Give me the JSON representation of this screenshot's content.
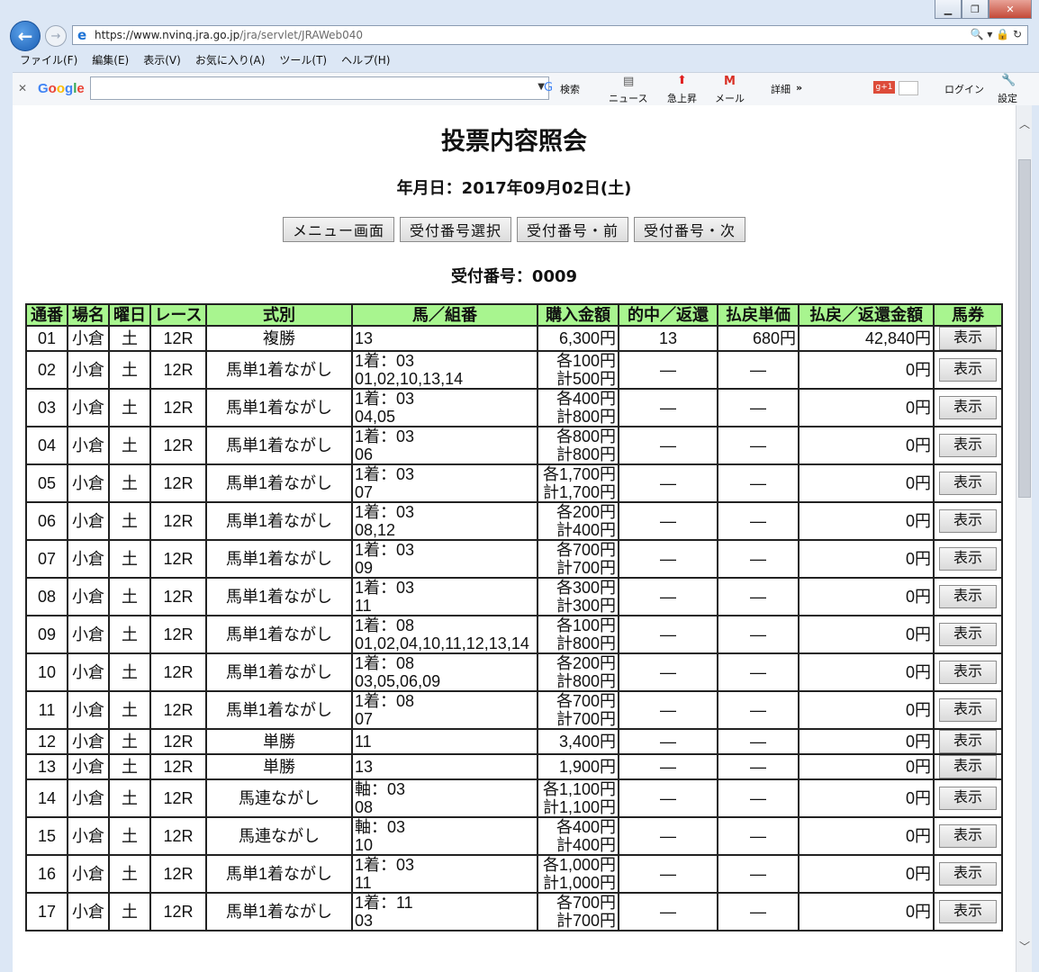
{
  "browser": {
    "url_host": "https://www.nvinq.jra.go.jp",
    "url_path": "/jra/servlet/JRAWeb040",
    "url_tools": "🔍 ▾ 🔒 ↻",
    "menu": [
      "ファイル(F)",
      "編集(E)",
      "表示(V)",
      "お気に入り(A)",
      "ツール(T)",
      "ヘルプ(H)"
    ],
    "toolbar": {
      "google_logo": "Google",
      "search_btn": "検索",
      "news": "ニュース",
      "trending": "急上昇",
      "mail": "メール",
      "details": "詳細",
      "more": "»",
      "login": "ログイン",
      "settings": "設定"
    }
  },
  "page": {
    "title": "投票内容照会",
    "date_line": "年月日：2017年09月02日(土)",
    "buttons": [
      "メニュー画面",
      "受付番号選択",
      "受付番号・前",
      "受付番号・次"
    ],
    "receipt_line": "受付番号：0009"
  },
  "table": {
    "headers": [
      "通番",
      "場名",
      "曜日",
      "レース",
      "式別",
      "馬／組番",
      "購入金額",
      "的中／返還",
      "払戻単価",
      "払戻／返還金額",
      "馬券"
    ],
    "rows": [
      {
        "no": "01",
        "venue": "小倉",
        "day": "土",
        "race": "12R",
        "type": "複勝",
        "combo1": "13",
        "combo2": "",
        "amt1": "6,300円",
        "amt2": "",
        "hit": "13",
        "unit": "680円",
        "payout": "42,840円",
        "btn": "表示"
      },
      {
        "no": "02",
        "venue": "小倉",
        "day": "土",
        "race": "12R",
        "type": "馬単1着ながし",
        "combo1": "1着：03",
        "combo2": "01,02,10,13,14",
        "amt1": "各100円",
        "amt2": "計500円",
        "hit": "—",
        "unit": "—",
        "payout": "0円",
        "btn": "表示"
      },
      {
        "no": "03",
        "venue": "小倉",
        "day": "土",
        "race": "12R",
        "type": "馬単1着ながし",
        "combo1": "1着：03",
        "combo2": "04,05",
        "amt1": "各400円",
        "amt2": "計800円",
        "hit": "—",
        "unit": "—",
        "payout": "0円",
        "btn": "表示"
      },
      {
        "no": "04",
        "venue": "小倉",
        "day": "土",
        "race": "12R",
        "type": "馬単1着ながし",
        "combo1": "1着：03",
        "combo2": "06",
        "amt1": "各800円",
        "amt2": "計800円",
        "hit": "—",
        "unit": "—",
        "payout": "0円",
        "btn": "表示"
      },
      {
        "no": "05",
        "venue": "小倉",
        "day": "土",
        "race": "12R",
        "type": "馬単1着ながし",
        "combo1": "1着：03",
        "combo2": "07",
        "amt1": "各1,700円",
        "amt2": "計1,700円",
        "hit": "—",
        "unit": "—",
        "payout": "0円",
        "btn": "表示"
      },
      {
        "no": "06",
        "venue": "小倉",
        "day": "土",
        "race": "12R",
        "type": "馬単1着ながし",
        "combo1": "1着：03",
        "combo2": "08,12",
        "amt1": "各200円",
        "amt2": "計400円",
        "hit": "—",
        "unit": "—",
        "payout": "0円",
        "btn": "表示"
      },
      {
        "no": "07",
        "venue": "小倉",
        "day": "土",
        "race": "12R",
        "type": "馬単1着ながし",
        "combo1": "1着：03",
        "combo2": "09",
        "amt1": "各700円",
        "amt2": "計700円",
        "hit": "—",
        "unit": "—",
        "payout": "0円",
        "btn": "表示"
      },
      {
        "no": "08",
        "venue": "小倉",
        "day": "土",
        "race": "12R",
        "type": "馬単1着ながし",
        "combo1": "1着：03",
        "combo2": "11",
        "amt1": "各300円",
        "amt2": "計300円",
        "hit": "—",
        "unit": "—",
        "payout": "0円",
        "btn": "表示"
      },
      {
        "no": "09",
        "venue": "小倉",
        "day": "土",
        "race": "12R",
        "type": "馬単1着ながし",
        "combo1": "1着：08",
        "combo2": "01,02,04,10,11,12,13,14",
        "amt1": "各100円",
        "amt2": "計800円",
        "hit": "—",
        "unit": "—",
        "payout": "0円",
        "btn": "表示"
      },
      {
        "no": "10",
        "venue": "小倉",
        "day": "土",
        "race": "12R",
        "type": "馬単1着ながし",
        "combo1": "1着：08",
        "combo2": "03,05,06,09",
        "amt1": "各200円",
        "amt2": "計800円",
        "hit": "—",
        "unit": "—",
        "payout": "0円",
        "btn": "表示"
      },
      {
        "no": "11",
        "venue": "小倉",
        "day": "土",
        "race": "12R",
        "type": "馬単1着ながし",
        "combo1": "1着：08",
        "combo2": "07",
        "amt1": "各700円",
        "amt2": "計700円",
        "hit": "—",
        "unit": "—",
        "payout": "0円",
        "btn": "表示"
      },
      {
        "no": "12",
        "venue": "小倉",
        "day": "土",
        "race": "12R",
        "type": "単勝",
        "combo1": "11",
        "combo2": "",
        "amt1": "3,400円",
        "amt2": "",
        "hit": "—",
        "unit": "—",
        "payout": "0円",
        "btn": "表示"
      },
      {
        "no": "13",
        "venue": "小倉",
        "day": "土",
        "race": "12R",
        "type": "単勝",
        "combo1": "13",
        "combo2": "",
        "amt1": "1,900円",
        "amt2": "",
        "hit": "—",
        "unit": "—",
        "payout": "0円",
        "btn": "表示"
      },
      {
        "no": "14",
        "venue": "小倉",
        "day": "土",
        "race": "12R",
        "type": "馬連ながし",
        "combo1": "軸：03",
        "combo2": "08",
        "amt1": "各1,100円",
        "amt2": "計1,100円",
        "hit": "—",
        "unit": "—",
        "payout": "0円",
        "btn": "表示"
      },
      {
        "no": "15",
        "venue": "小倉",
        "day": "土",
        "race": "12R",
        "type": "馬連ながし",
        "combo1": "軸：03",
        "combo2": "10",
        "amt1": "各400円",
        "amt2": "計400円",
        "hit": "—",
        "unit": "—",
        "payout": "0円",
        "btn": "表示"
      },
      {
        "no": "16",
        "venue": "小倉",
        "day": "土",
        "race": "12R",
        "type": "馬単1着ながし",
        "combo1": "1着：03",
        "combo2": "11",
        "amt1": "各1,000円",
        "amt2": "計1,000円",
        "hit": "—",
        "unit": "—",
        "payout": "0円",
        "btn": "表示"
      },
      {
        "no": "17",
        "venue": "小倉",
        "day": "土",
        "race": "12R",
        "type": "馬単1着ながし",
        "combo1": "1着：11",
        "combo2": "03",
        "amt1": "各700円",
        "amt2": "計700円",
        "hit": "—",
        "unit": "—",
        "payout": "0円",
        "btn": "表示"
      }
    ]
  },
  "colors": {
    "header_bg": "#a8f58f",
    "hit_text": "#e01010"
  }
}
